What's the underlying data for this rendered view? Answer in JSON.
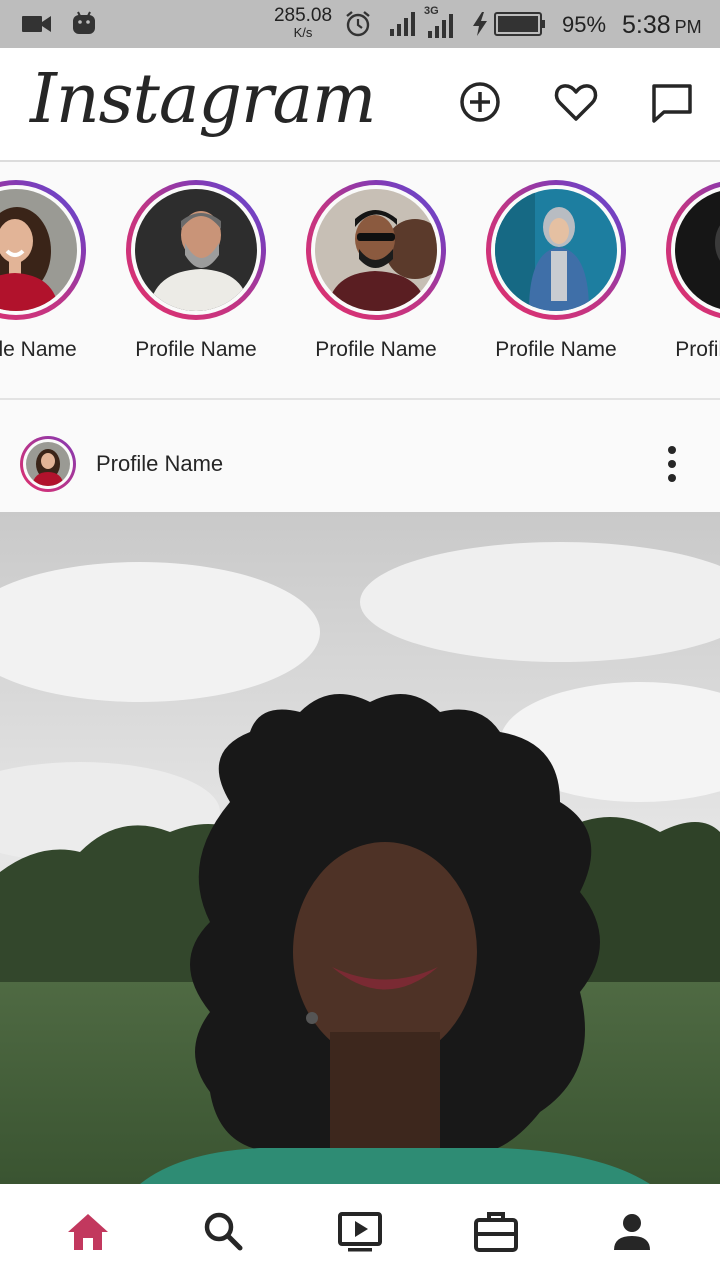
{
  "status_bar": {
    "speed_value": "285.08",
    "speed_unit": "K/s",
    "network": "3G",
    "battery_percent": "95%",
    "time": "5:38",
    "ampm": "PM",
    "icons": [
      "video-camera-icon",
      "android-icon",
      "alarm-icon",
      "signal-icon",
      "signal-3g-icon",
      "charging-icon",
      "battery-icon"
    ]
  },
  "header": {
    "logo_text": "Instagram",
    "actions": [
      "add-post-icon",
      "heart-icon",
      "message-icon"
    ]
  },
  "stories": [
    {
      "name": "Profile Name"
    },
    {
      "name": "Profile Name"
    },
    {
      "name": "Profile Name"
    },
    {
      "name": "Profile Name"
    },
    {
      "name": "Profile Name"
    }
  ],
  "post": {
    "author": "Profile Name",
    "menu_icon": "more-vertical-icon"
  },
  "bottom_nav": {
    "items": [
      "home-icon",
      "search-icon",
      "video-icon",
      "shop-icon",
      "profile-icon"
    ],
    "active": "home-icon"
  },
  "colors": {
    "active": "#c2385e",
    "icon": "#262626",
    "story_gradient": [
      "#e1306c",
      "#c13584",
      "#833ab4",
      "#5851db"
    ],
    "status_bar_bg": "#bdbdbd"
  }
}
